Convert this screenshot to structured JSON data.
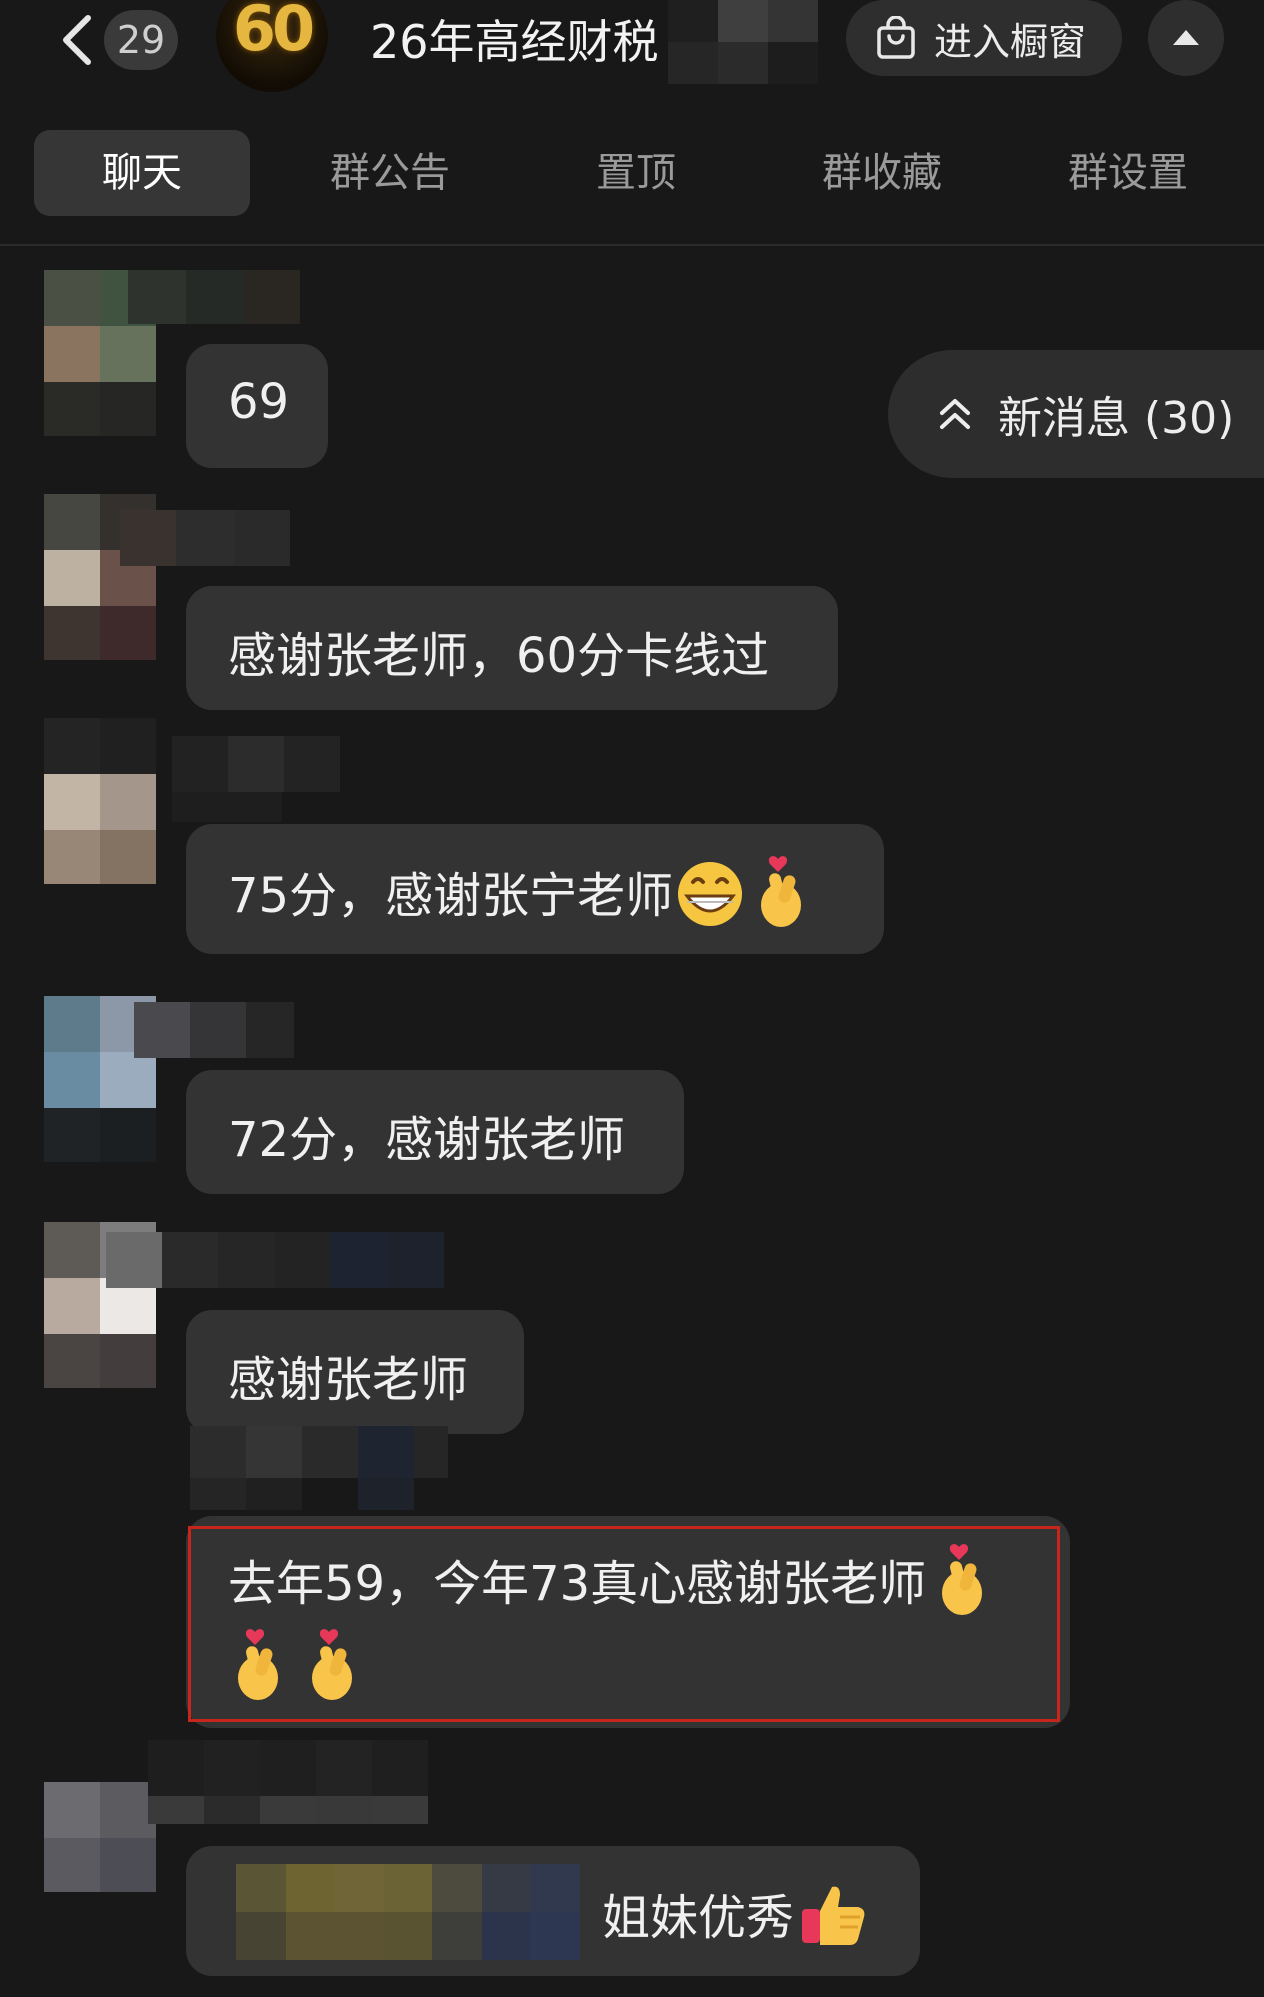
{
  "header": {
    "back_icon": "chevron-left-icon",
    "unread_count": "29",
    "group_avatar_text": "60",
    "title": "26年高经财税",
    "shop_label": "进入橱窗",
    "shop_icon": "shopping-bag-icon",
    "collapse_icon": "caret-up-icon"
  },
  "tabs": [
    {
      "label": "聊天",
      "active": true
    },
    {
      "label": "群公告",
      "active": false
    },
    {
      "label": "置顶",
      "active": false
    },
    {
      "label": "群收藏",
      "active": false
    },
    {
      "label": "群设置",
      "active": false
    }
  ],
  "new_messages": {
    "label": "新消息 (30)",
    "icon": "double-chevron-up-icon"
  },
  "messages": [
    {
      "text": "69"
    },
    {
      "text": "感谢张老师，60分卡线过"
    },
    {
      "text": "75分，感谢张宁老师",
      "emojis": [
        "grinning-face-icon",
        "finger-heart-icon"
      ]
    },
    {
      "text": "72分，感谢张老师"
    },
    {
      "text": "感谢张老师"
    },
    {
      "text": "去年59，今年73真心感谢张老师",
      "emojis": [
        "finger-heart-icon",
        "finger-heart-icon",
        "finger-heart-icon"
      ],
      "highlighted": true
    },
    {
      "text": "姐妹优秀",
      "emojis": [
        "thumbs-up-icon"
      ]
    }
  ],
  "colors": {
    "background": "#181818",
    "bubble": "#333333",
    "highlight_border": "#c8261c",
    "tab_active": "#363636"
  }
}
